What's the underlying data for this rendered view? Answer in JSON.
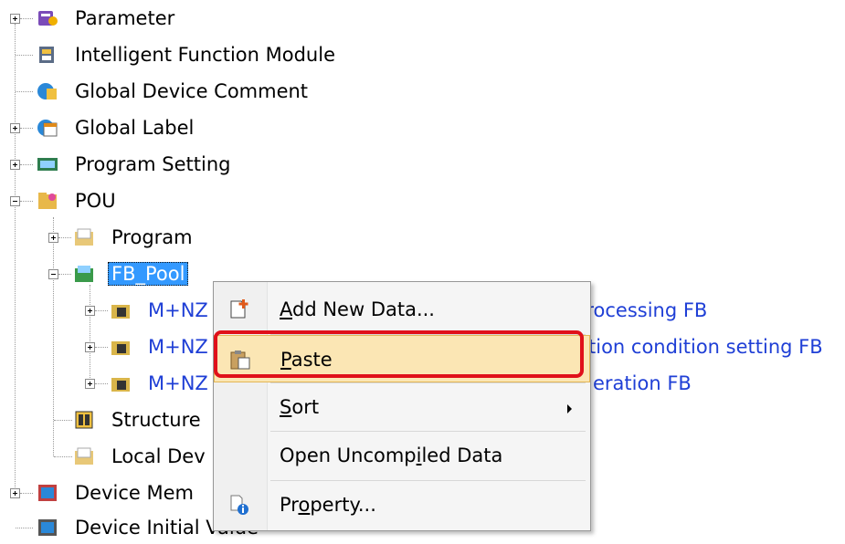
{
  "tree": {
    "parameter": "Parameter",
    "intelligent_function_module": "Intelligent Function Module",
    "global_device_comment": "Global Device Comment",
    "global_label": "Global Label",
    "program_setting": "Program Setting",
    "pou": "POU",
    "program": "Program",
    "fb_pool": "FB_Pool",
    "fb_items": [
      {
        "prefix": "M+NZ",
        "suffix": "processing FB"
      },
      {
        "prefix": "M+NZ",
        "suffix": "tion condition setting FB"
      },
      {
        "prefix": "M+NZ",
        "suffix": "eration FB"
      }
    ],
    "structure": "Structure",
    "local_device": "Local Dev",
    "device_memory": "Device Mem",
    "device_initial_value": "Device Initial Value"
  },
  "context_menu": {
    "add_new_data": {
      "before": "",
      "key": "A",
      "after": "dd New Data..."
    },
    "paste": {
      "before": "",
      "key": "P",
      "after": "aste"
    },
    "sort": {
      "before": "",
      "key": "S",
      "after": "ort"
    },
    "open_uncompiled": {
      "before": "Open Uncomp",
      "key": "i",
      "after": "led Data"
    },
    "property": {
      "before": "Pr",
      "key": "o",
      "after": "perty..."
    }
  },
  "colors": {
    "highlight": "#e0101a",
    "selection": "#3399ff",
    "link_blue": "#1f3fd6"
  }
}
